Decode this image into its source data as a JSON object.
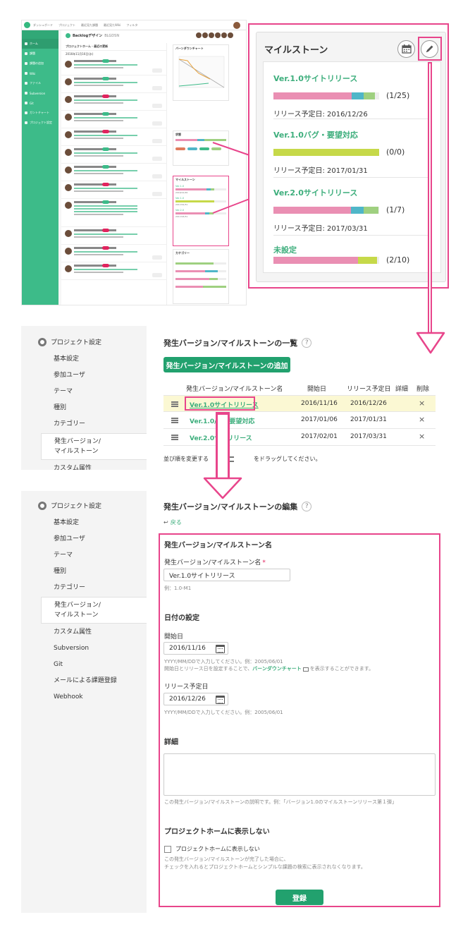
{
  "mini": {
    "nav": [
      "ダッシュボード",
      "プロジェクト",
      "最近見た課題",
      "最近見たWiki",
      "フィルタ"
    ],
    "side_items": [
      "ホーム",
      "課題",
      "課題の追加",
      "Wiki",
      "ファイル",
      "Subversion",
      "Git",
      "ガントチャート",
      "プロジェクト設定"
    ],
    "project_title": "Backlogデザイン",
    "project_key": "BLGDSN",
    "feed_header": "プロジェクトホーム · 最近の更新",
    "feed_date": "2016年11月16日(水)",
    "burndown_title": "バーンダウンチャート",
    "status_title": "状態",
    "milestone_title": "マイルストーン",
    "category_title": "カテゴリー"
  },
  "milestone_card": {
    "title": "マイルストーン",
    "colors": {
      "pink": "#ea8fb3",
      "teal": "#4fb6c8",
      "green": "#9fd080",
      "lime": "#c6d949"
    },
    "items": [
      {
        "name": "Ver.1.0サイトリリース",
        "count": "(1/25)",
        "date": "リリース予定日: 2016/12/26",
        "segments": [
          0.78,
          0.1,
          0.1
        ]
      },
      {
        "name": "Ver.1.0バグ・要望対応",
        "count": "(0/0)",
        "date": "リリース予定日: 2017/01/31",
        "segments": [
          0,
          0,
          0,
          1
        ]
      },
      {
        "name": "Ver.2.0サイトリリース",
        "count": "(1/7)",
        "date": "リリース予定日: 2017/03/31",
        "segments": [
          0.72,
          0.12,
          0.14
        ]
      },
      {
        "name": "未設定",
        "count": "(2/10)",
        "date": "",
        "segments": [
          0.8,
          0,
          0.18
        ]
      }
    ]
  },
  "settings": {
    "header": "プロジェクト設定",
    "items_list": [
      "基本設定",
      "参加ユーザ",
      "テーマ",
      "種別",
      "カテゴリー",
      "発生バージョン/\nマイルストーン",
      "カスタム属性"
    ],
    "items_form": [
      "基本設定",
      "参加ユーザ",
      "テーマ",
      "種別",
      "カテゴリー",
      "発生バージョン/\nマイルストーン",
      "カスタム属性",
      "Subversion",
      "Git",
      "メールによる課題登録",
      "Webhook"
    ]
  },
  "list_page": {
    "title": "発生バージョン/マイルストーンの一覧",
    "help": "?",
    "add_button": "発生バージョン/マイルストーンの追加",
    "columns": [
      "発生バージョン/マイルストーン名",
      "開始日",
      "リリース予定日",
      "詳細",
      "削除"
    ],
    "rows": [
      {
        "name": "Ver.1.0サイトリリース",
        "start": "2016/11/16",
        "release": "2016/12/26",
        "delete": "×"
      },
      {
        "name": "Ver.1.0/　　要望対応",
        "start": "2017/01/06",
        "release": "2017/01/31",
        "delete": "×"
      },
      {
        "name": "Ver.2.0サ　リリース",
        "start": "2017/02/01",
        "release": "2017/03/31",
        "delete": "×"
      }
    ],
    "reorder_note_pre": "並び順を変更する",
    "reorder_note_post": "をドラッグしてください。"
  },
  "edit_page": {
    "title": "発生バージョン/マイルストーンの編集",
    "help": "?",
    "back": "戻る",
    "sec_name": "発生バージョン/マイルストーン名",
    "name_label": "発生バージョン/マイルストーン名",
    "required": "*",
    "name_value": "Ver.1.0サイトリリース",
    "name_hint": "例：1.0-M1",
    "sec_date": "日付の設定",
    "start_label": "開始日",
    "start_value": "2016/11/16",
    "date_hint": "YYYY/MM/DDで入力してください。例：2005/06/01",
    "burndown_pre": "開始日とリリース日を設定することで、",
    "burndown_link": "バーンダウンチャート",
    "burndown_post": "を表示することができます。",
    "release_label": "リリース予定日",
    "release_value": "2016/12/26",
    "release_hint": "YYYY/MM/DDで入力してください。例：2005/06/01",
    "sec_detail": "詳細",
    "detail_hint": "この発生バージョン/マイルストーンの説明です。例：「バージョン1.0のマイルストーンリリース第１弾」",
    "sec_hide": "プロジェクトホームに表示しない",
    "hide_checkbox": "プロジェクトホームに表示しない",
    "hide_hint1": "この発生バージョン/マイルストーンが完了した場合に、",
    "hide_hint2": "チェックを入れるとプロジェクトホームとシンプルな課題の検索に表示されなくなります。",
    "submit": "登録"
  }
}
